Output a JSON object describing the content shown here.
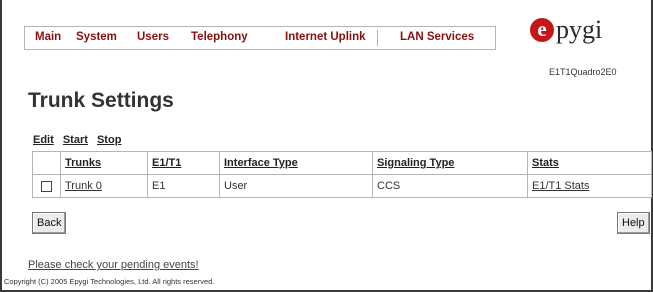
{
  "nav": {
    "items": [
      "Main",
      "System",
      "Users",
      "Telephony",
      "Internet Uplink",
      "LAN Services"
    ]
  },
  "logo": {
    "mark": "e",
    "text": "pygi",
    "model": "E1T1Quadro2E0"
  },
  "page": {
    "title": "Trunk Settings"
  },
  "actions": {
    "edit": "Edit",
    "start": "Start",
    "stop": "Stop"
  },
  "table": {
    "headers": [
      "Trunks",
      "E1/T1",
      "Interface Type",
      "Signaling Type",
      "Stats"
    ],
    "rows": [
      {
        "trunk": "Trunk 0",
        "type": "E1",
        "interface": "User",
        "signaling": "CCS",
        "stats": "E1/T1 Stats"
      }
    ]
  },
  "buttons": {
    "back": "Back",
    "help": "Help"
  },
  "footer": {
    "pending": "Please check your pending events!",
    "copyright": "Copyright (C) 2005 Epygi Technologies, Ltd. All rights reserved."
  }
}
